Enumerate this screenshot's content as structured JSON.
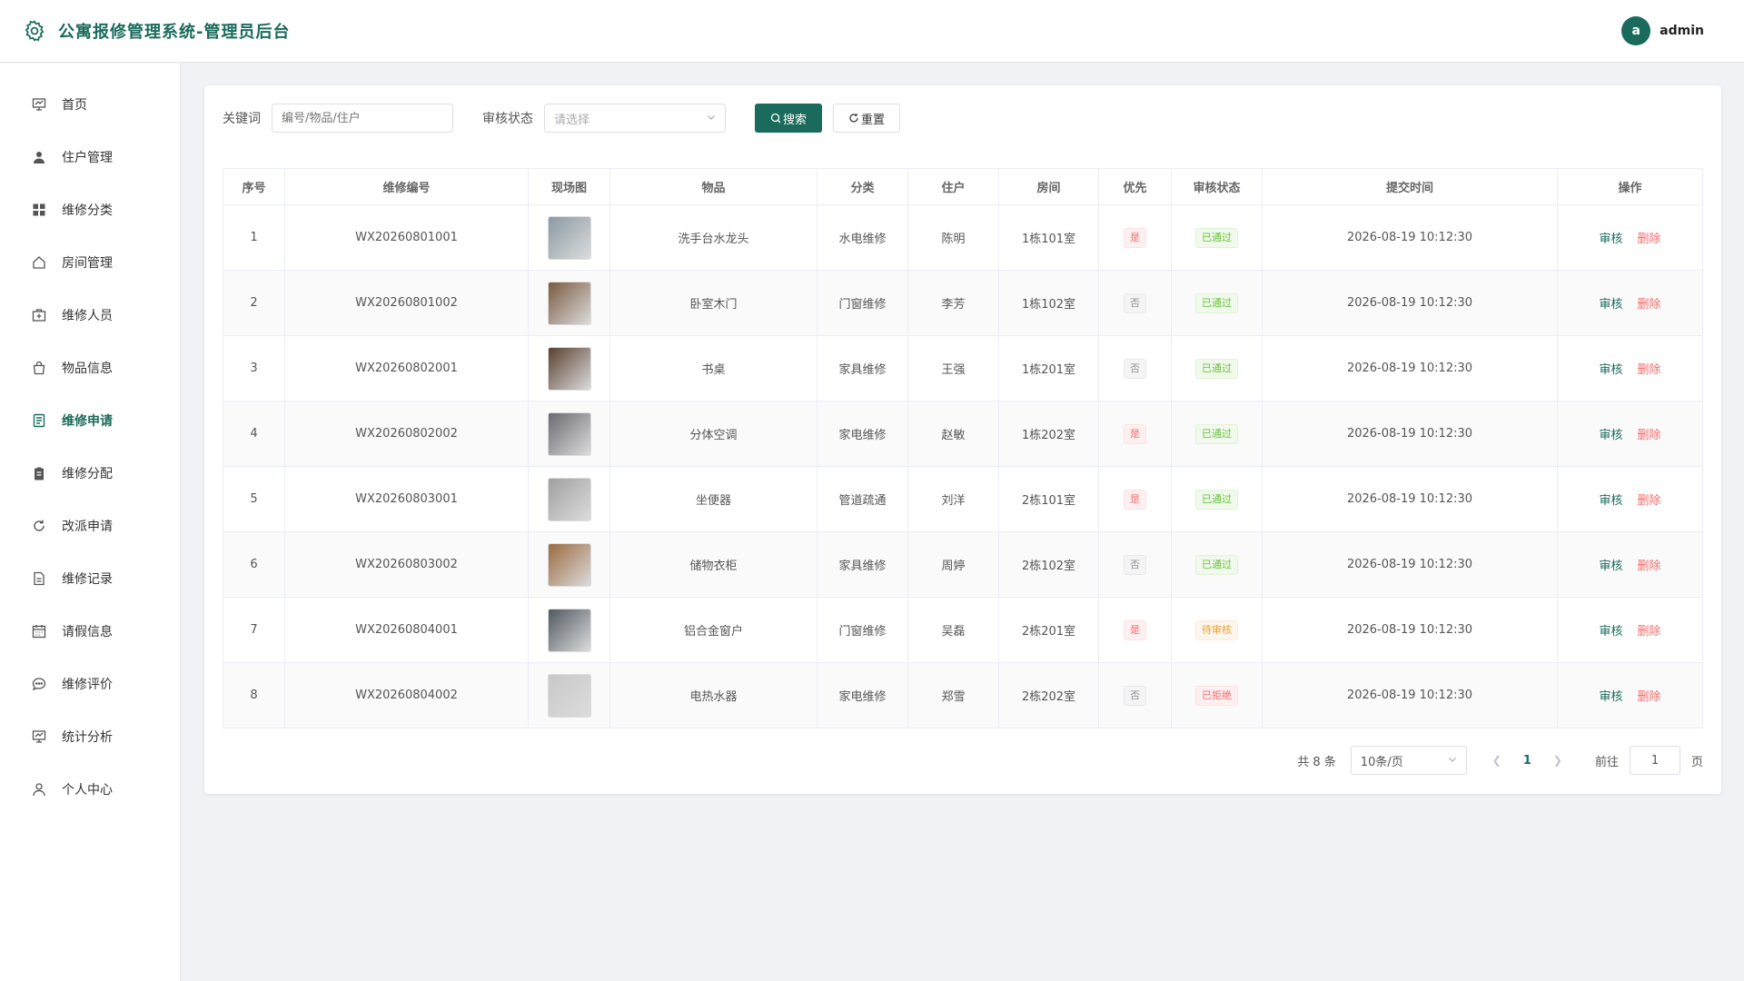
{
  "header": {
    "title": "公寓报修管理系统-管理员后台",
    "avatar_letter": "a",
    "username": "admin"
  },
  "sidebar": {
    "items": [
      {
        "label": "首页",
        "icon": "dashboard-icon"
      },
      {
        "label": "住户管理",
        "icon": "user-icon"
      },
      {
        "label": "维修分类",
        "icon": "grid-icon"
      },
      {
        "label": "房间管理",
        "icon": "house-icon"
      },
      {
        "label": "维修人员",
        "icon": "first-aid-icon"
      },
      {
        "label": "物品信息",
        "icon": "bag-icon"
      },
      {
        "label": "维修申请",
        "icon": "document-icon",
        "active": true
      },
      {
        "label": "维修分配",
        "icon": "clipboard-icon"
      },
      {
        "label": "改派申请",
        "icon": "refresh-icon"
      },
      {
        "label": "维修记录",
        "icon": "record-icon"
      },
      {
        "label": "请假信息",
        "icon": "calendar-icon"
      },
      {
        "label": "维修评价",
        "icon": "chat-icon"
      },
      {
        "label": "统计分析",
        "icon": "chart-icon"
      },
      {
        "label": "个人中心",
        "icon": "profile-icon"
      }
    ]
  },
  "search": {
    "keyword_label": "关键词",
    "keyword_placeholder": "编号/物品/住户",
    "status_label": "审核状态",
    "status_placeholder": "请选择",
    "search_button": "搜索",
    "reset_button": "重置"
  },
  "table": {
    "columns": [
      "序号",
      "维修编号",
      "现场图",
      "物品",
      "分类",
      "住户",
      "房间",
      "优先",
      "审核状态",
      "提交时间",
      "操作"
    ],
    "rows": [
      {
        "no": "1",
        "code": "WX20260801001",
        "item": "洗手台水龙头",
        "category": "水电维修",
        "resident": "陈明",
        "room": "1栋101室",
        "priority": "是",
        "status": "已通过",
        "time": "2026-08-19 10:12:30",
        "thumb_color": "#8a9aa3"
      },
      {
        "no": "2",
        "code": "WX20260801002",
        "item": "卧室木门",
        "category": "门窗维修",
        "resident": "李芳",
        "room": "1栋102室",
        "priority": "否",
        "status": "已通过",
        "time": "2026-08-19 10:12:30",
        "thumb_color": "#7a5a40"
      },
      {
        "no": "3",
        "code": "WX20260802001",
        "item": "书桌",
        "category": "家具维修",
        "resident": "王强",
        "room": "1栋201室",
        "priority": "否",
        "status": "已通过",
        "time": "2026-08-19 10:12:30",
        "thumb_color": "#5a4030"
      },
      {
        "no": "4",
        "code": "WX20260802002",
        "item": "分体空调",
        "category": "家电维修",
        "resident": "赵敏",
        "room": "1栋202室",
        "priority": "是",
        "status": "已通过",
        "time": "2026-08-19 10:12:30",
        "thumb_color": "#6a6a70"
      },
      {
        "no": "5",
        "code": "WX20260803001",
        "item": "坐便器",
        "category": "管道疏通",
        "resident": "刘洋",
        "room": "2栋101室",
        "priority": "是",
        "status": "已通过",
        "time": "2026-08-19 10:12:30",
        "thumb_color": "#a0a0a0"
      },
      {
        "no": "6",
        "code": "WX20260803002",
        "item": "储物衣柜",
        "category": "家具维修",
        "resident": "周婷",
        "room": "2栋102室",
        "priority": "否",
        "status": "已通过",
        "time": "2026-08-19 10:12:30",
        "thumb_color": "#9a6a40"
      },
      {
        "no": "7",
        "code": "WX20260804001",
        "item": "铝合金窗户",
        "category": "门窗维修",
        "resident": "吴磊",
        "room": "2栋201室",
        "priority": "是",
        "status": "待审核",
        "time": "2026-08-19 10:12:30",
        "thumb_color": "#505860"
      },
      {
        "no": "8",
        "code": "WX20260804002",
        "item": "电热水器",
        "category": "家电维修",
        "resident": "郑雪",
        "room": "2栋202室",
        "priority": "否",
        "status": "已拒绝",
        "time": "2026-08-19 10:12:30",
        "thumb_color": "#c8c8c8"
      }
    ],
    "op_audit": "审核",
    "op_delete": "删除"
  },
  "pagination": {
    "total_text": "共 8 条",
    "page_size": "10条/页",
    "current_page": "1",
    "goto_label": "前往",
    "goto_value": "1",
    "page_suffix": "页"
  },
  "colors": {
    "primary": "#1a6b5c",
    "danger": "#f56c6c",
    "success": "#67c23a",
    "warning": "#e6a23c"
  }
}
